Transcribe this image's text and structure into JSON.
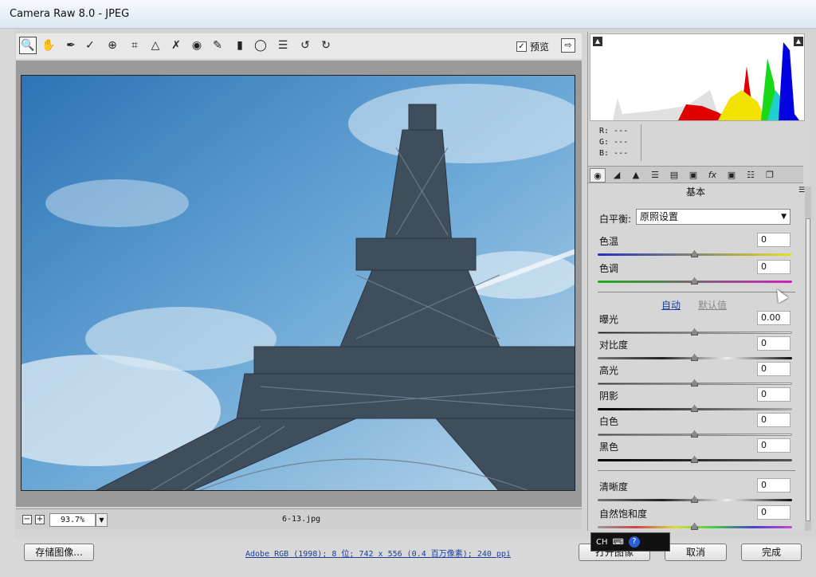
{
  "window": {
    "title": "Camera Raw 8.0 -  JPEG"
  },
  "toolbar": {
    "tools": [
      "zoom-icon",
      "hand-icon",
      "white-balance-icon",
      "color-sampler-icon",
      "target-adjust-icon",
      "crop-icon",
      "straighten-icon",
      "spot-removal-icon",
      "red-eye-icon",
      "adjustment-brush-icon",
      "graduated-filter-icon",
      "radial-filter-icon",
      "preferences-icon",
      "rotate-left-icon",
      "rotate-right-icon"
    ],
    "preview_label": "预览",
    "preview_checked": true
  },
  "image": {
    "zoom": "93.7%",
    "filename": "6-13.jpg"
  },
  "histogram": {
    "r": "R:  ---",
    "g": "G:  ---",
    "b": "B:  ---"
  },
  "panel": {
    "section_title": "基本",
    "white_balance_label": "白平衡:",
    "white_balance_value": "原照设置",
    "auto_label": "自动",
    "default_label": "默认值",
    "sliders_wb": [
      {
        "label": "色温",
        "value": "0"
      },
      {
        "label": "色调",
        "value": "0"
      }
    ],
    "sliders_tone": [
      {
        "label": "曝光",
        "value": "0.00"
      },
      {
        "label": "对比度",
        "value": "0"
      },
      {
        "label": "高光",
        "value": "0"
      },
      {
        "label": "阴影",
        "value": "0"
      },
      {
        "label": "白色",
        "value": "0"
      },
      {
        "label": "黑色",
        "value": "0"
      }
    ],
    "sliders_presence": [
      {
        "label": "清晰度",
        "value": "0"
      },
      {
        "label": "自然饱和度",
        "value": "0"
      }
    ]
  },
  "bottom": {
    "save_label": "存储图像...",
    "info_text": "Adobe RGB (1998); 8 位; 742 x 556 (0.4 百万像素); 240 ppi",
    "open_label": "打开图像",
    "cancel_label": "取消",
    "done_label": "完成",
    "ime_label": "CH"
  }
}
